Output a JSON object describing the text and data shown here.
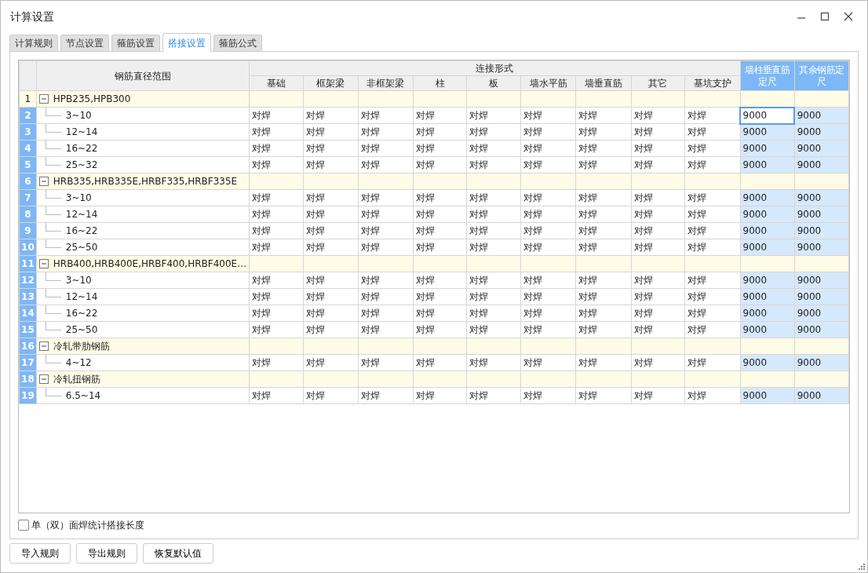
{
  "window": {
    "title": "计算设置"
  },
  "tabs": [
    {
      "label": "计算规则",
      "selected": false
    },
    {
      "label": "节点设置",
      "selected": false
    },
    {
      "label": "箍筋设置",
      "selected": false
    },
    {
      "label": "搭接设置",
      "selected": true
    },
    {
      "label": "箍筋公式",
      "selected": false
    }
  ],
  "table": {
    "range_header": "钢筋直径范围",
    "group_header": "连接形式",
    "columns": [
      "基础",
      "框架梁",
      "非框架梁",
      "柱",
      "板",
      "墙水平筋",
      "墙垂直筋",
      "其它",
      "基坑支护"
    ],
    "length_columns": [
      {
        "label": "墙柱垂直筋定尺",
        "selected": true
      },
      {
        "label": "其余钢筋定尺",
        "selected": true
      }
    ],
    "groups": [
      {
        "row": "1",
        "label": "HPB235,HPB300",
        "expanded": true,
        "selected": false,
        "children": [
          {
            "row": "2",
            "label": "3~10",
            "selected": true,
            "values": [
              "对焊",
              "对焊",
              "对焊",
              "对焊",
              "对焊",
              "对焊",
              "对焊",
              "对焊",
              "对焊"
            ],
            "lengths": [
              {
                "value": "9000",
                "current": true
              },
              {
                "value": "9000",
                "current": false
              }
            ]
          },
          {
            "row": "3",
            "label": "12~14",
            "selected": true,
            "values": [
              "对焊",
              "对焊",
              "对焊",
              "对焊",
              "对焊",
              "对焊",
              "对焊",
              "对焊",
              "对焊"
            ],
            "lengths": [
              {
                "value": "9000",
                "current": false
              },
              {
                "value": "9000",
                "current": false
              }
            ]
          },
          {
            "row": "4",
            "label": "16~22",
            "selected": true,
            "values": [
              "对焊",
              "对焊",
              "对焊",
              "对焊",
              "对焊",
              "对焊",
              "对焊",
              "对焊",
              "对焊"
            ],
            "lengths": [
              {
                "value": "9000",
                "current": false
              },
              {
                "value": "9000",
                "current": false
              }
            ]
          },
          {
            "row": "5",
            "label": "25~32",
            "selected": true,
            "values": [
              "对焊",
              "对焊",
              "对焊",
              "对焊",
              "对焊",
              "对焊",
              "对焊",
              "对焊",
              "对焊"
            ],
            "lengths": [
              {
                "value": "9000",
                "current": false
              },
              {
                "value": "9000",
                "current": false
              }
            ]
          }
        ]
      },
      {
        "row": "6",
        "label": "HRB335,HRB335E,HRBF335,HRBF335E",
        "expanded": true,
        "selected": true,
        "children": [
          {
            "row": "7",
            "label": "3~10",
            "selected": true,
            "values": [
              "对焊",
              "对焊",
              "对焊",
              "对焊",
              "对焊",
              "对焊",
              "对焊",
              "对焊",
              "对焊"
            ],
            "lengths": [
              {
                "value": "9000",
                "current": false
              },
              {
                "value": "9000",
                "current": false
              }
            ]
          },
          {
            "row": "8",
            "label": "12~14",
            "selected": true,
            "values": [
              "对焊",
              "对焊",
              "对焊",
              "对焊",
              "对焊",
              "对焊",
              "对焊",
              "对焊",
              "对焊"
            ],
            "lengths": [
              {
                "value": "9000",
                "current": false
              },
              {
                "value": "9000",
                "current": false
              }
            ]
          },
          {
            "row": "9",
            "label": "16~22",
            "selected": true,
            "values": [
              "对焊",
              "对焊",
              "对焊",
              "对焊",
              "对焊",
              "对焊",
              "对焊",
              "对焊",
              "对焊"
            ],
            "lengths": [
              {
                "value": "9000",
                "current": false
              },
              {
                "value": "9000",
                "current": false
              }
            ]
          },
          {
            "row": "10",
            "label": "25~50",
            "selected": true,
            "values": [
              "对焊",
              "对焊",
              "对焊",
              "对焊",
              "对焊",
              "对焊",
              "对焊",
              "对焊",
              "对焊"
            ],
            "lengths": [
              {
                "value": "9000",
                "current": false
              },
              {
                "value": "9000",
                "current": false
              }
            ]
          }
        ]
      },
      {
        "row": "11",
        "label": "HRB400,HRB400E,HRBF400,HRBF400E…",
        "expanded": true,
        "selected": true,
        "children": [
          {
            "row": "12",
            "label": "3~10",
            "selected": true,
            "values": [
              "对焊",
              "对焊",
              "对焊",
              "对焊",
              "对焊",
              "对焊",
              "对焊",
              "对焊",
              "对焊"
            ],
            "lengths": [
              {
                "value": "9000",
                "current": false
              },
              {
                "value": "9000",
                "current": false
              }
            ]
          },
          {
            "row": "13",
            "label": "12~14",
            "selected": true,
            "values": [
              "对焊",
              "对焊",
              "对焊",
              "对焊",
              "对焊",
              "对焊",
              "对焊",
              "对焊",
              "对焊"
            ],
            "lengths": [
              {
                "value": "9000",
                "current": false
              },
              {
                "value": "9000",
                "current": false
              }
            ]
          },
          {
            "row": "14",
            "label": "16~22",
            "selected": true,
            "values": [
              "对焊",
              "对焊",
              "对焊",
              "对焊",
              "对焊",
              "对焊",
              "对焊",
              "对焊",
              "对焊"
            ],
            "lengths": [
              {
                "value": "9000",
                "current": false
              },
              {
                "value": "9000",
                "current": false
              }
            ]
          },
          {
            "row": "15",
            "label": "25~50",
            "selected": true,
            "values": [
              "对焊",
              "对焊",
              "对焊",
              "对焊",
              "对焊",
              "对焊",
              "对焊",
              "对焊",
              "对焊"
            ],
            "lengths": [
              {
                "value": "9000",
                "current": false
              },
              {
                "value": "9000",
                "current": false
              }
            ]
          }
        ]
      },
      {
        "row": "16",
        "label": "冷轧带肋钢筋",
        "expanded": true,
        "selected": true,
        "children": [
          {
            "row": "17",
            "label": "4~12",
            "selected": true,
            "values": [
              "对焊",
              "对焊",
              "对焊",
              "对焊",
              "对焊",
              "对焊",
              "对焊",
              "对焊",
              "对焊"
            ],
            "lengths": [
              {
                "value": "9000",
                "current": false
              },
              {
                "value": "9000",
                "current": false
              }
            ]
          }
        ]
      },
      {
        "row": "18",
        "label": "冷轧扭钢筋",
        "expanded": true,
        "selected": true,
        "children": [
          {
            "row": "19",
            "label": "6.5~14",
            "selected": true,
            "values": [
              "对焊",
              "对焊",
              "对焊",
              "对焊",
              "对焊",
              "对焊",
              "对焊",
              "对焊",
              "对焊"
            ],
            "lengths": [
              {
                "value": "9000",
                "current": false
              },
              {
                "value": "9000",
                "current": false
              }
            ]
          }
        ]
      }
    ]
  },
  "option": {
    "label": "单（双）面焊统计搭接长度",
    "checked": false
  },
  "buttons": [
    "导入规则",
    "导出规则",
    "恢复默认值"
  ]
}
